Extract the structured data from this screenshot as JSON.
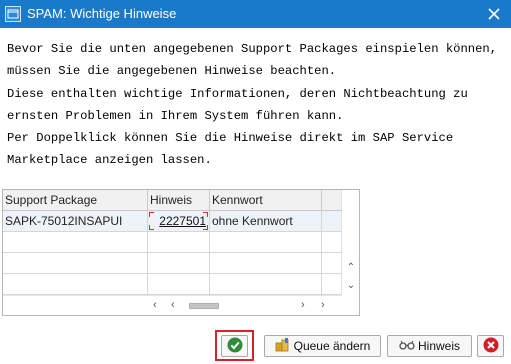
{
  "window": {
    "title": "SPAM: Wichtige Hinweise",
    "close_icon": "close-icon",
    "app_icon": "sap-window-icon"
  },
  "message_lines": [
    "Bevor Sie die unten angegebenen Support Packages einspielen können,",
    "müssen Sie die angegebenen Hinweise beachten.",
    "Diese enthalten wichtige Informationen, deren Nichtbeachtung zu",
    "ernsten Problemen in Ihrem System führen kann.",
    "Per Doppelklick können Sie die Hinweise direkt im SAP Service",
    "Marketplace anzeigen lassen."
  ],
  "table": {
    "columns": [
      "Support Package",
      "Hinweis",
      "Kennwort"
    ],
    "rows": [
      {
        "support_package": "SAPK-75012INSAPUI",
        "hinweis": "2227501",
        "kennwort": "ohne Kennwort"
      }
    ],
    "empty_rows": 3
  },
  "buttons": {
    "ok_icon": "check-icon",
    "queue_label": "Queue ändern",
    "queue_icon": "queue-edit-icon",
    "hinweis_label": "Hinweis",
    "hinweis_icon": "glasses-icon",
    "cancel_icon": "cancel-icon"
  },
  "colors": {
    "titlebar": "#1979ca",
    "highlight_frame": "#d8232a",
    "ok_green": "#2e8b3a",
    "cancel_red": "#d21f26"
  }
}
